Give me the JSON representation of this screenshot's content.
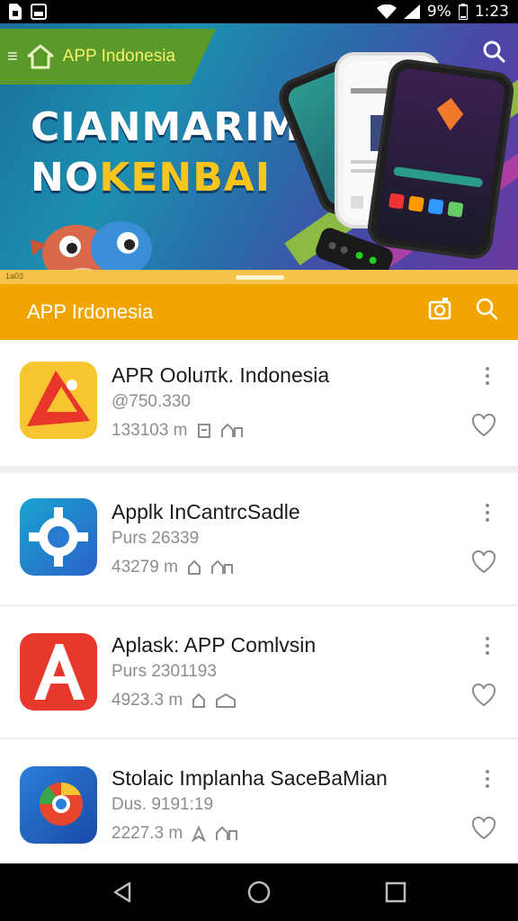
{
  "status_bar": {
    "battery": "9%",
    "time": "1:23",
    "icons": [
      "sim-card-icon",
      "image-icon",
      "wifi-icon",
      "signal-icon",
      "battery-icon"
    ]
  },
  "hero": {
    "tab_title": "APP Indonesia",
    "headline_line1": "CIANMARIM",
    "headline_line2_a": "NO",
    "headline_line2_b": "KENBAI",
    "colors": {
      "tab": "#5a9a2a",
      "accent_yellow": "#f8c51c"
    }
  },
  "appbar": {
    "title": "APP Irdonesia",
    "handle_label": "1a03",
    "color": "#f0a500"
  },
  "apps": [
    {
      "name": "APR Ooluπk. Indonesia",
      "sub": "@750.330",
      "size": "133103 m",
      "meta_icons": [
        "document-icon",
        "share-icon"
      ]
    },
    {
      "name": "Applk InCantrcSadle",
      "sub": "Purs 26339",
      "size": "43279 m",
      "meta_icons": [
        "home-icon",
        "share-icon"
      ]
    },
    {
      "name": "Aplask: APP Comlvsin",
      "sub": "Purs 2301193",
      "size": "4923.3 m",
      "meta_icons": [
        "home-icon",
        "home-icon"
      ]
    },
    {
      "name": "Stolaic Implanha SaceBaMian",
      "sub": "Dus. 9191:19",
      "size": "2227.3 m",
      "meta_icons": [
        "send-icon",
        "share-icon"
      ]
    }
  ],
  "navbar": {
    "buttons": [
      "back-icon",
      "home-icon",
      "recents-icon"
    ]
  }
}
